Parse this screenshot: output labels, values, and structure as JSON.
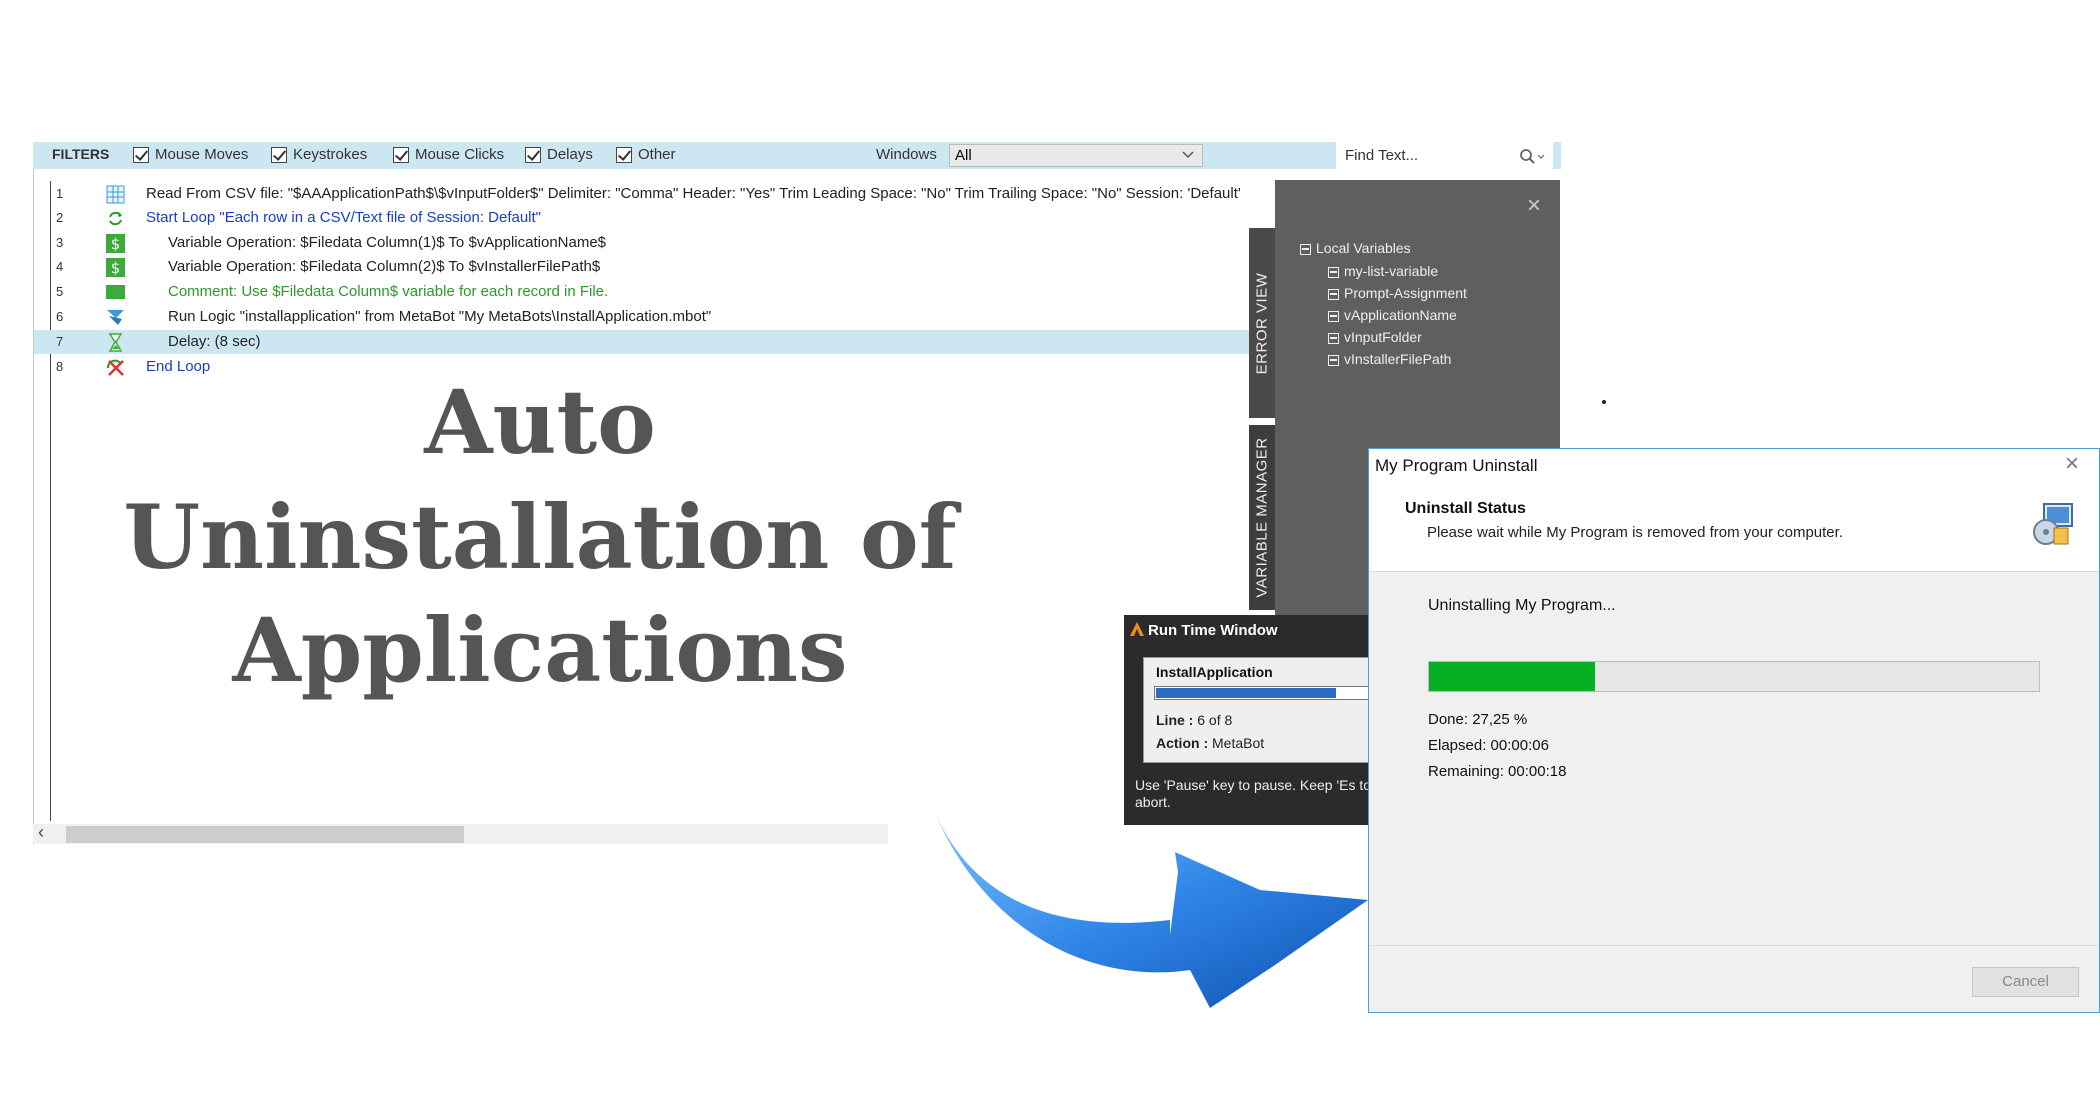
{
  "filters": {
    "label": "FILTERS",
    "items": [
      {
        "label": "Mouse Moves",
        "checked": true
      },
      {
        "label": "Keystrokes",
        "checked": true
      },
      {
        "label": "Mouse Clicks",
        "checked": true
      },
      {
        "label": "Delays",
        "checked": true
      },
      {
        "label": "Other",
        "checked": true
      }
    ],
    "windows_label": "Windows",
    "windows_value": "All",
    "find_placeholder": "Find Text..."
  },
  "script": {
    "lines": [
      {
        "num": "1",
        "text": "Read From CSV file: \"$AAApplicationPath$\\$vInputFolder$\" Delimiter: \"Comma\" Header: \"Yes\" Trim Leading Space: \"No\" Trim Trailing Space: \"No\" Session: 'Default'",
        "icon": "table-icon"
      },
      {
        "num": "2",
        "text": "Start Loop \"Each row in a CSV/Text file of Session: Default\"",
        "icon": "loop-icon"
      },
      {
        "num": "3",
        "text": "Variable Operation: $Filedata Column(1)$ To $vApplicationName$",
        "icon": "dollar-icon"
      },
      {
        "num": "4",
        "text": "Variable Operation: $Filedata Column(2)$ To $vInstallerFilePath$",
        "icon": "dollar-icon"
      },
      {
        "num": "5",
        "text": "Comment: Use $Filedata Column$ variable for each record in File.",
        "icon": "comment-icon"
      },
      {
        "num": "6",
        "text": "Run Logic \"installapplication\" from MetaBot \"My MetaBots\\InstallApplication.mbot\"",
        "icon": "metabot-icon"
      },
      {
        "num": "7",
        "text": "Delay: (8 sec)",
        "icon": "hourglass-icon"
      },
      {
        "num": "8",
        "text": "End Loop",
        "icon": "end-loop-icon"
      }
    ]
  },
  "side_panel": {
    "tab_error": "ERROR VIEW",
    "tab_variables": "VARIABLE MANAGER",
    "root": "Local Variables",
    "variables": [
      "my-list-variable",
      "Prompt-Assignment",
      "vApplicationName",
      "vInputFolder",
      "vInstallerFilePath"
    ]
  },
  "headline": [
    "Auto",
    "Uninstallation of",
    "Applications"
  ],
  "runtime": {
    "title": "Run Time Window",
    "task": "InstallApplication",
    "progress": 0.85,
    "line_label": "Line :",
    "line_value": "6 of 8",
    "action_label": "Action :",
    "action_value": "MetaBot",
    "footer": "Use 'Pause' key to pause. Keep 'Es to abort."
  },
  "dialog": {
    "title": "My Program Uninstall",
    "heading": "Uninstall Status",
    "subheading": "Please wait while My Program is removed from your computer.",
    "message": "Uninstalling My Program...",
    "progress_percent": 27.25,
    "done": "Done: 27,25 %",
    "elapsed": "Elapsed: 00:00:06",
    "remaining": "Remaining: 00:00:18",
    "cancel": "Cancel"
  },
  "colors": {
    "filter_bar": "#cce7f2",
    "progress_green": "#06b025",
    "arrow_blue": "#2f86e8",
    "headline": "#555555"
  }
}
